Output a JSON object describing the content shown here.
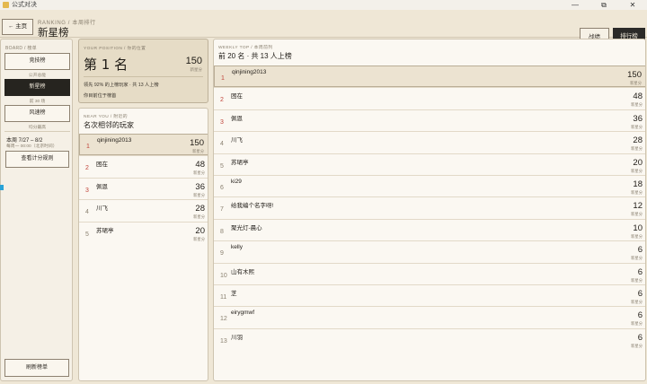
{
  "window": {
    "title": "公式对决",
    "buttons": [
      "—",
      "⧉",
      "✕"
    ]
  },
  "header": {
    "back_label": "← 主页",
    "crumb": "RANKING / 本周排行",
    "title": "新星榜",
    "battle_label": "战绩",
    "ranking_label": "排行榜"
  },
  "sidebar": {
    "head": "BOARD / 榜单",
    "boards": [
      {
        "label": "竞技榜",
        "sub": "公开总能"
      },
      {
        "label": "新星榜",
        "sub": "前 30 场",
        "active": true
      },
      {
        "label": "风速榜",
        "sub": "均分最高"
      }
    ],
    "week": "本周 7/27 – 8/2",
    "reset": "每周一 00:00（北京时间）",
    "rules_label": "查看计分规则",
    "refresh_label": "刷新榜单"
  },
  "position": {
    "label": "YOUR POSITION / 你的位置",
    "rank_text": "第 1 名",
    "score": "150",
    "unit": "新星分",
    "line1": "领先 92% 的上榜玩家 · 共 13 人上榜",
    "line2": "你目前位于榜首"
  },
  "near": {
    "label": "NEAR YOU / 附近的",
    "title": "名次相邻的玩家",
    "rows": [
      {
        "rank": "1",
        "name": "qinjining2013",
        "score": "150",
        "unit": "新星分"
      },
      {
        "rank": "2",
        "name": "困在",
        "score": "48",
        "unit": "新星分"
      },
      {
        "rank": "3",
        "name": "佩恩",
        "score": "36",
        "unit": "新星分"
      },
      {
        "rank": "4",
        "name": "川飞",
        "score": "28",
        "unit": "新星分"
      },
      {
        "rank": "5",
        "name": "苏珺亭",
        "score": "20",
        "unit": "新星分"
      }
    ]
  },
  "weekly": {
    "label": "WEEKLY TOP / 本周前列",
    "title": "前 20 名 · 共 13 人上榜",
    "rows": [
      {
        "rank": "1",
        "name": "qinjining2013",
        "score": "150",
        "unit": "新星分"
      },
      {
        "rank": "2",
        "name": "困在",
        "score": "48",
        "unit": "新星分"
      },
      {
        "rank": "3",
        "name": "佩恩",
        "score": "36",
        "unit": "新星分"
      },
      {
        "rank": "4",
        "name": "川飞",
        "score": "28",
        "unit": "新星分"
      },
      {
        "rank": "5",
        "name": "苏珺亭",
        "score": "20",
        "unit": "新星分"
      },
      {
        "rank": "6",
        "name": "ki29",
        "score": "18",
        "unit": "新星分"
      },
      {
        "rank": "7",
        "name": "给我编个名字呀!",
        "score": "12",
        "unit": "新星分"
      },
      {
        "rank": "8",
        "name": "聚光灯-晨心",
        "score": "10",
        "unit": "新星分"
      },
      {
        "rank": "9",
        "name": "kelly",
        "score": "6",
        "unit": "新星分"
      },
      {
        "rank": "10",
        "name": "山有木熙",
        "score": "6",
        "unit": "新星分"
      },
      {
        "rank": "11",
        "name": "芝",
        "score": "6",
        "unit": "新星分"
      },
      {
        "rank": "12",
        "name": "eirygmwf",
        "score": "6",
        "unit": "新星分"
      },
      {
        "rank": "13",
        "name": "川羽",
        "score": "6",
        "unit": "新星分"
      }
    ]
  }
}
